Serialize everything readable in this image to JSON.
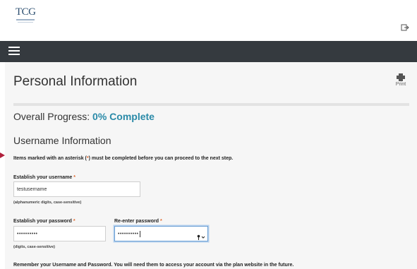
{
  "logo": {
    "text": "TCG"
  },
  "icons": {
    "logout": "logout-icon",
    "menu": "hamburger-menu-icon",
    "print": "printer-icon",
    "key": "key-dropdown-icon"
  },
  "colors": {
    "navbar": "#353a3f",
    "accent": "#2a8aa8",
    "required": "#e0662a",
    "content_bg": "#f6f6f6"
  },
  "page": {
    "title": "Personal Information",
    "print_label": "Print"
  },
  "progress": {
    "label": "Overall Progress: ",
    "value": "0% Complete",
    "percent": 0
  },
  "section": {
    "title": "Username Information"
  },
  "note": {
    "before": "Items marked with an asterisk (",
    "asterisk": "*",
    "after": ") must be completed before you can proceed to the next step."
  },
  "form": {
    "username": {
      "label": "Establish your username",
      "required": "*",
      "value": "testusername",
      "hint": "(alphanumeric digits, case-sensitive)"
    },
    "password": {
      "label": "Establish your password",
      "required": "*",
      "value": "••••••••••",
      "hint": "(digits, case-sensitive)"
    },
    "reenter": {
      "label": "Re-enter password",
      "required": "*",
      "value": "••••••••••"
    }
  },
  "reminder": "Remember your Username and Password. You will need them to access your account via the plan website in the future."
}
